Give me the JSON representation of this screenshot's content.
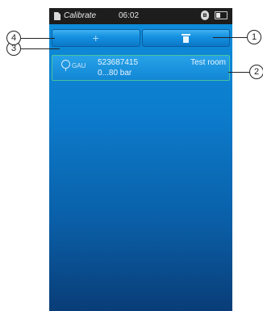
{
  "status_bar": {
    "app_name": "Calibrate",
    "time": "06:02",
    "icons": [
      "document-icon",
      "bluetooth-icon",
      "battery-icon"
    ]
  },
  "toolbar": {
    "add_label": "+",
    "delete_icon": "trash-icon"
  },
  "list": {
    "items": [
      {
        "type": "GAU",
        "serial": "523687415",
        "range": "0...80 bar",
        "location": "Test room",
        "icon": "gauge-icon"
      }
    ]
  },
  "callouts": [
    "1",
    "2",
    "3",
    "4"
  ],
  "colors": {
    "background_top": "#0f8fdc",
    "background_bottom": "#093d77",
    "item_border": "#48c4a0",
    "status_bar": "#1d1d1d"
  }
}
